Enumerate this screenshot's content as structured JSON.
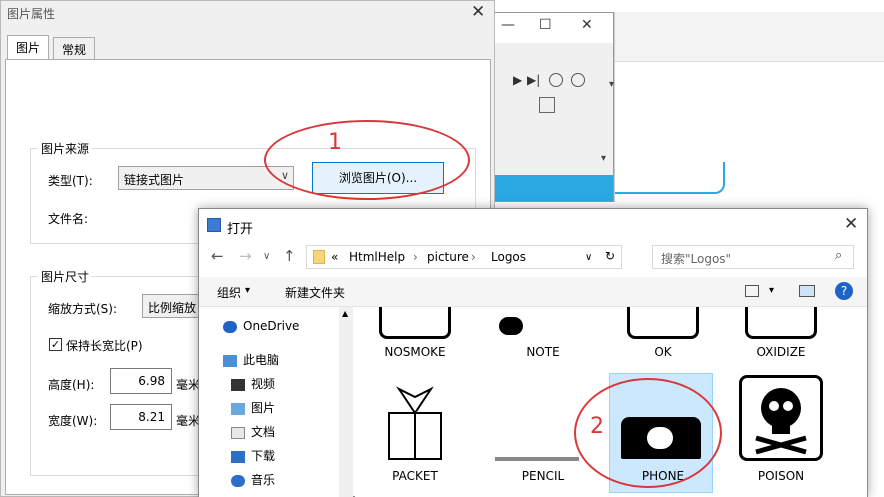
{
  "property_dialog": {
    "title": "图片属性",
    "tabs": [
      "图片",
      "常规"
    ],
    "source_group": {
      "label": "图片来源",
      "type_label": "类型(T):",
      "type_value": "链接式图片",
      "browse_button": "浏览图片(O)...",
      "filename_label": "文件名:"
    },
    "size_group": {
      "label": "图片尺寸",
      "scale_label": "缩放方式(S):",
      "scale_value": "比例缩放",
      "keep_ratio_label": "保持长宽比(P)",
      "keep_ratio_checked": true,
      "height_label": "高度(H):",
      "height_value": "6.98",
      "width_label": "宽度(W):",
      "width_value": "8.21",
      "unit": "毫米"
    }
  },
  "open_dialog": {
    "title": "打开",
    "breadcrumb": [
      "«",
      "HtmlHelp",
      "picture",
      "Logos"
    ],
    "search_placeholder": "搜索\"Logos\"",
    "toolbar": {
      "organize": "组织",
      "new_folder": "新建文件夹"
    },
    "nav_items": [
      "OneDrive",
      "此电脑",
      "视频",
      "图片",
      "文档",
      "下载",
      "音乐"
    ],
    "files_row1": [
      "NOSMOKE",
      "NOTE",
      "OK",
      "OXIDIZE"
    ],
    "files_row2": [
      "PACKET",
      "PENCIL",
      "PHONE",
      "POISON"
    ],
    "selected_file": "PHONE"
  },
  "annotations": [
    "1",
    "2"
  ],
  "colors": {
    "accent": "#0078d7",
    "annotation": "#d9383a",
    "selection": "#cce8ff"
  }
}
